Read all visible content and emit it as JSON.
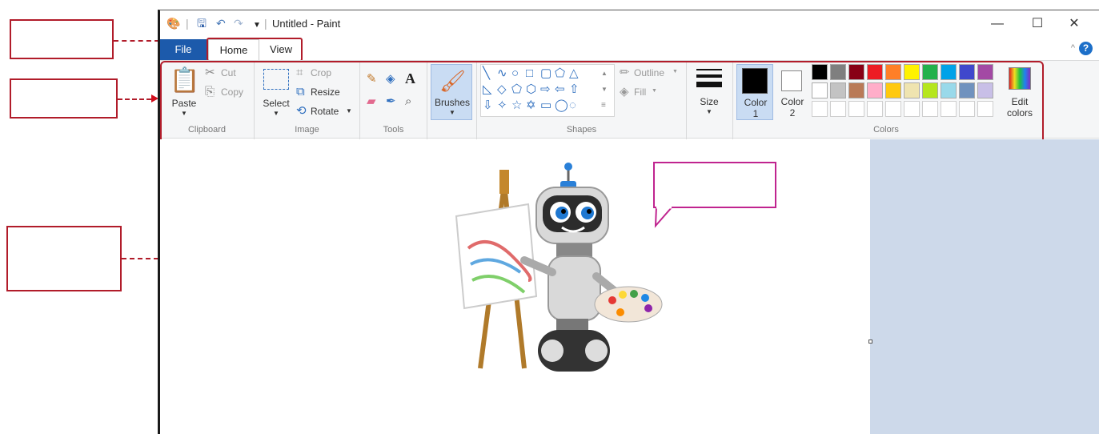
{
  "quick_access": {
    "title": "Untitled - Paint"
  },
  "window_controls": {
    "minimize": "—",
    "maximize": "☐",
    "close": "✕"
  },
  "tabs": {
    "file": "File",
    "home": "Home",
    "view": "View"
  },
  "ribbon": {
    "clipboard": {
      "label": "Clipboard",
      "paste": "Paste",
      "cut": "Cut",
      "copy": "Copy"
    },
    "image": {
      "label": "Image",
      "select": "Select",
      "crop": "Crop",
      "resize": "Resize",
      "rotate": "Rotate"
    },
    "tools": {
      "label": "Tools"
    },
    "brushes": {
      "label": "Brushes"
    },
    "shapes": {
      "label": "Shapes",
      "outline": "Outline",
      "fill": "Fill"
    },
    "size": {
      "label": "Size"
    },
    "colors": {
      "label": "Colors",
      "color1": "Color",
      "color1_num": "1",
      "color2": "Color",
      "color2_num": "2",
      "edit": "Edit",
      "edit2": "colors",
      "color1_value": "#000000",
      "color2_value": "#ffffff",
      "palette_row1": [
        "#000000",
        "#7f7f7f",
        "#880015",
        "#ed1c24",
        "#ff7f27",
        "#fff200",
        "#22b14c",
        "#00a2e8",
        "#3f48cc",
        "#a349a4"
      ],
      "palette_row2": [
        "#ffffff",
        "#c3c3c3",
        "#b97a57",
        "#ffaec9",
        "#ffc90e",
        "#efe4b0",
        "#b5e61d",
        "#99d9ea",
        "#7092be",
        "#c8bfe7"
      ]
    }
  },
  "accent": {
    "file_tab": "#1c5aab",
    "annotation": "#b11c2a",
    "callout": "#c0248f"
  }
}
